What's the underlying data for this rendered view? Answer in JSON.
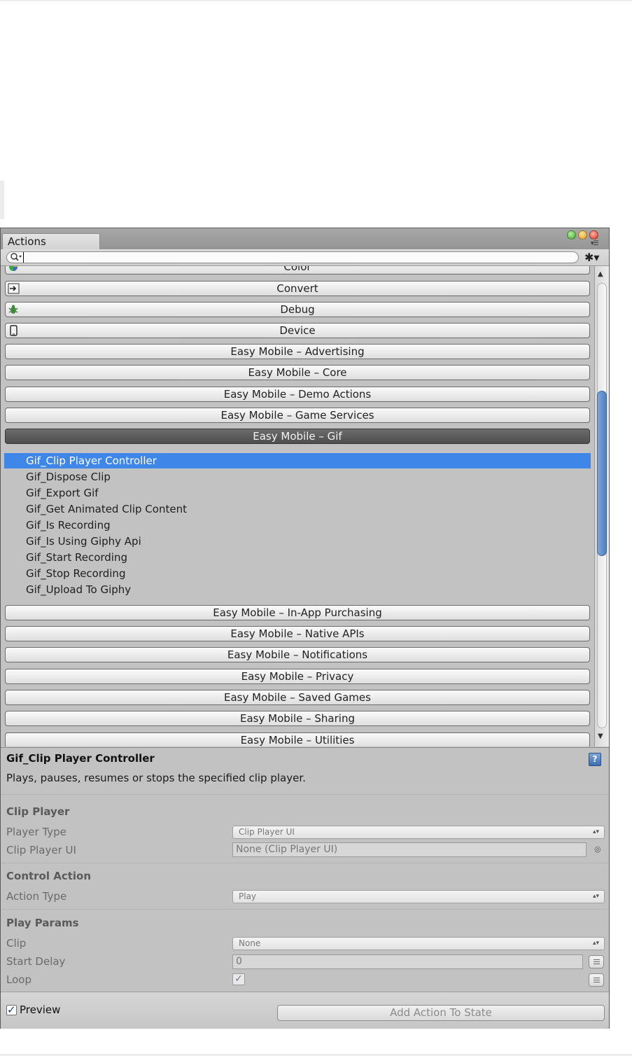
{
  "window": {
    "tab_label": "Actions"
  },
  "search": {
    "value": ""
  },
  "categories_before": [
    {
      "label": "Color",
      "icon": "color-wheel-icon"
    },
    {
      "label": "Convert",
      "icon": "convert-icon"
    },
    {
      "label": "Debug",
      "icon": "bug-icon"
    },
    {
      "label": "Device",
      "icon": "device-icon"
    },
    {
      "label": "Easy Mobile – Advertising"
    },
    {
      "label": "Easy Mobile – Core"
    },
    {
      "label": "Easy Mobile – Demo Actions"
    },
    {
      "label": "Easy Mobile – Game Services"
    }
  ],
  "selected_category": {
    "label": "Easy Mobile – Gif"
  },
  "actions": [
    {
      "label": "Gif_Clip Player Controller",
      "selected": true
    },
    {
      "label": "Gif_Dispose Clip"
    },
    {
      "label": "Gif_Export Gif"
    },
    {
      "label": "Gif_Get Animated Clip Content"
    },
    {
      "label": "Gif_Is Recording"
    },
    {
      "label": "Gif_Is Using Giphy Api"
    },
    {
      "label": "Gif_Start Recording"
    },
    {
      "label": "Gif_Stop Recording"
    },
    {
      "label": "Gif_Upload To Giphy"
    }
  ],
  "categories_after": [
    {
      "label": "Easy Mobile – In-App Purchasing"
    },
    {
      "label": "Easy Mobile – Native APIs"
    },
    {
      "label": "Easy Mobile – Notifications"
    },
    {
      "label": "Easy Mobile – Privacy"
    },
    {
      "label": "Easy Mobile – Saved Games"
    },
    {
      "label": "Easy Mobile – Sharing"
    },
    {
      "label": "Easy Mobile – Utilities"
    }
  ],
  "details": {
    "title": "Gif_Clip Player Controller",
    "description": "Plays, pauses, resumes or stops the specified clip player.",
    "sections": {
      "clip_player": {
        "title": "Clip Player",
        "player_type_label": "Player Type",
        "player_type_value": "Clip Player UI",
        "clip_player_ui_label": "Clip Player UI",
        "clip_player_ui_value": "None (Clip Player UI)"
      },
      "control_action": {
        "title": "Control Action",
        "action_type_label": "Action Type",
        "action_type_value": "Play"
      },
      "play_params": {
        "title": "Play Params",
        "clip_label": "Clip",
        "clip_value": "None",
        "start_delay_label": "Start Delay",
        "start_delay_value": "0",
        "loop_label": "Loop",
        "loop_checked": true
      }
    }
  },
  "footer": {
    "preview_label": "Preview",
    "preview_checked": true,
    "add_button_label": "Add Action To State"
  },
  "colors": {
    "selection": "#3e86e8",
    "selected_category": "#5a5a5a",
    "panel_background": "#c2c2c2"
  }
}
